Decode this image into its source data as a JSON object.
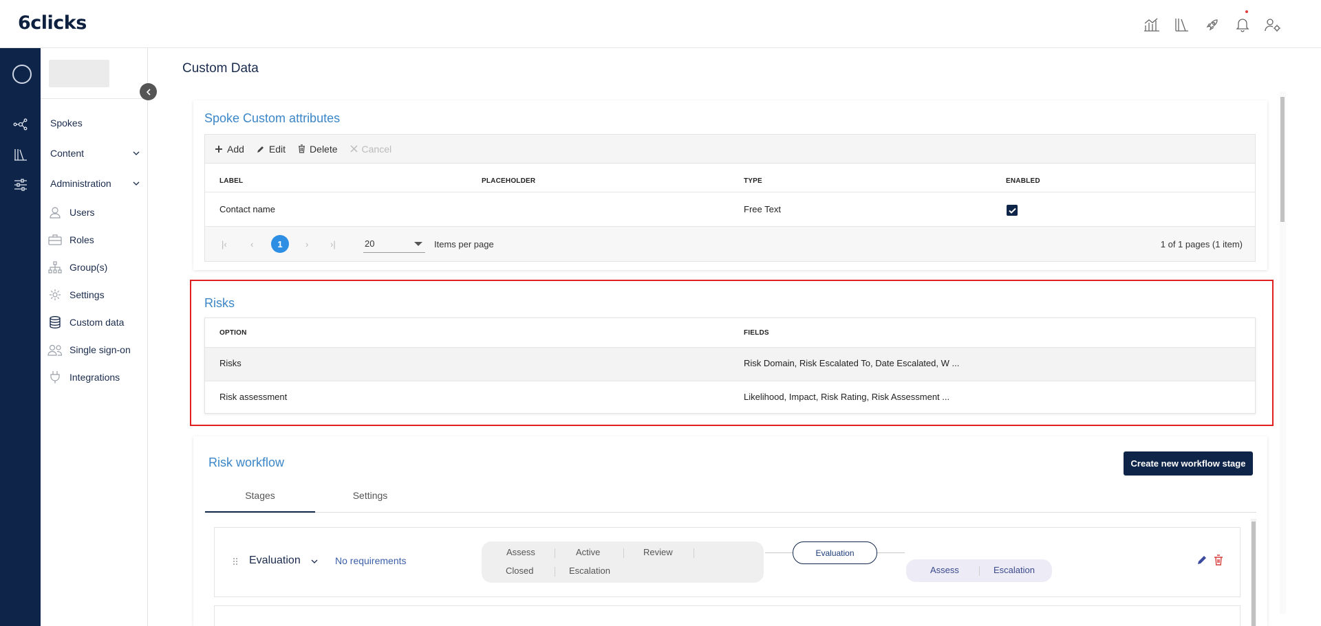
{
  "app": {
    "logo": "6clicks"
  },
  "header_icons": [
    "analytics-icon",
    "library-icon",
    "rocket-icon",
    "bell-icon",
    "user-settings-icon"
  ],
  "sidebar": {
    "collapse": "‹",
    "items": [
      {
        "label": "Spokes"
      },
      {
        "label": "Content",
        "chevron": "⌄"
      },
      {
        "label": "Administration",
        "chevron": "⌄"
      }
    ],
    "admin_items": [
      {
        "label": "Users",
        "icon": "user-icon"
      },
      {
        "label": "Roles",
        "icon": "briefcase-icon"
      },
      {
        "label": "Group(s)",
        "icon": "hierarchy-icon"
      },
      {
        "label": "Settings",
        "icon": "gear-icon"
      },
      {
        "label": "Custom data",
        "icon": "database-icon"
      },
      {
        "label": "Single sign-on",
        "icon": "users-icon"
      },
      {
        "label": "Integrations",
        "icon": "plug-icon"
      }
    ]
  },
  "page": {
    "title": "Custom Data"
  },
  "spoke_attributes": {
    "title": "Spoke Custom attributes",
    "toolbar": {
      "add": "Add",
      "edit": "Edit",
      "delete": "Delete",
      "cancel": "Cancel"
    },
    "columns": [
      "LABEL",
      "PLACEHOLDER",
      "TYPE",
      "ENABLED"
    ],
    "rows": [
      {
        "label": "Contact name",
        "placeholder": "",
        "type": "Free Text",
        "enabled": true
      }
    ],
    "pager": {
      "first": "|‹",
      "prev": "‹",
      "current": "1",
      "next": "›",
      "last": "›|",
      "page_size": "20",
      "page_size_label": "Items per page",
      "info": "1 of 1 pages (1 item)"
    }
  },
  "risks": {
    "title": "Risks",
    "columns": [
      "OPTION",
      "FIELDS"
    ],
    "rows": [
      {
        "option": "Risks",
        "fields": "Risk Domain, Risk Escalated To, Date Escalated, W ..."
      },
      {
        "option": "Risk assessment",
        "fields": "Likelihood, Impact, Risk Rating, Risk Assessment ..."
      }
    ]
  },
  "risk_workflow": {
    "title": "Risk workflow",
    "create_button": "Create new workflow stage",
    "tabs": [
      "Stages",
      "Settings"
    ],
    "active_tab": "Stages",
    "stage": {
      "name": "Evaluation",
      "requirements": "No requirements",
      "from_states": [
        "Assess",
        "Active",
        "Review",
        "Closed",
        "Escalation"
      ],
      "current": "Evaluation",
      "to_states": [
        "Assess",
        "Escalation"
      ]
    }
  },
  "colors": {
    "accent": "#3b86c7",
    "brand_dark": "#0e2448",
    "pager_active": "#2d8ee3",
    "highlight": "#e02020"
  }
}
